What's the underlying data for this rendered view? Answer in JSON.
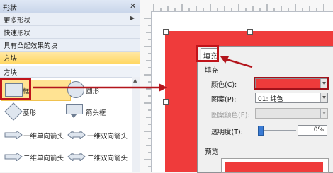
{
  "pane": {
    "title": "形状",
    "close": "✕",
    "menu": [
      {
        "label": "更多形状",
        "arrow": "▶"
      },
      {
        "label": "快速形状",
        "arrow": ""
      },
      {
        "label": "具有凸起效果的块",
        "arrow": ""
      },
      {
        "label": "方块",
        "arrow": ""
      }
    ],
    "stencil_title": "方块",
    "shapes": [
      {
        "label": "框",
        "icon": "rectangle-icon"
      },
      {
        "label": "圆形",
        "icon": "circle-icon"
      },
      {
        "label": "菱形",
        "icon": "diamond-icon"
      },
      {
        "label": "箭头框",
        "icon": "arrow-box-icon"
      },
      {
        "label": "一维单向箭头",
        "icon": "one-way-arrow-icon"
      },
      {
        "label": "一维双向箭头",
        "icon": "two-way-arrow-icon"
      },
      {
        "label": "二维单向箭头",
        "icon": "2d-one-way-arrow-icon"
      },
      {
        "label": "二维双向箭头",
        "icon": "2d-two-way-arrow-icon"
      }
    ]
  },
  "dialog": {
    "tab": "填充",
    "section": "填充",
    "color_label": "颜色(C):",
    "pattern_label": "图案(P):",
    "pattern_value": "01: 纯色",
    "pattern_color_label": "图案颜色(E):",
    "transparency_label": "透明度(T):",
    "transparency_value": "0%",
    "preview_label": "预览"
  },
  "colors": {
    "fill_red": "#ef3b3b",
    "highlight": "#c0141b"
  }
}
